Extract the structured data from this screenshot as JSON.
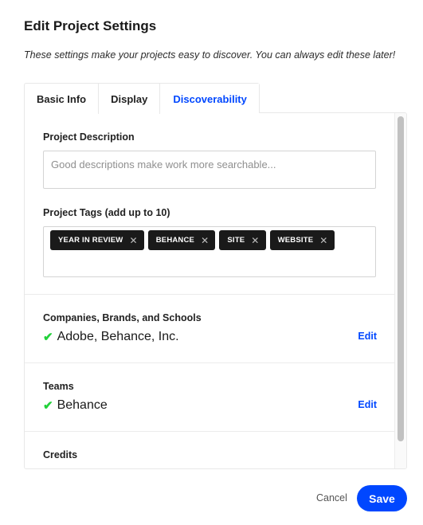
{
  "dialog": {
    "title": "Edit Project Settings",
    "subtitle": "These settings make your projects easy to discover. You can always edit these later!"
  },
  "tabs": [
    {
      "label": "Basic Info",
      "active": false
    },
    {
      "label": "Display",
      "active": false
    },
    {
      "label": "Discoverability",
      "active": true
    }
  ],
  "description": {
    "label": "Project Description",
    "value": "",
    "placeholder": "Good descriptions make work more searchable..."
  },
  "tags": {
    "label": "Project Tags (add up to 10)",
    "items": [
      "YEAR IN REVIEW",
      "BEHANCE",
      "SITE",
      "WEBSITE"
    ],
    "remove_glyph": "✕"
  },
  "companies": {
    "label": "Companies, Brands, and Schools",
    "value": "Adobe, Behance, Inc.",
    "edit_label": "Edit"
  },
  "teams": {
    "label": "Teams",
    "value": "Behance",
    "edit_label": "Edit"
  },
  "credits": {
    "label": "Credits"
  },
  "icons": {
    "check": "✔",
    "close": "✕"
  },
  "colors": {
    "accent": "#0047ff",
    "check": "#22d13a",
    "tag_bg": "#1a1a1a"
  },
  "footer": {
    "cancel_label": "Cancel",
    "save_label": "Save"
  }
}
